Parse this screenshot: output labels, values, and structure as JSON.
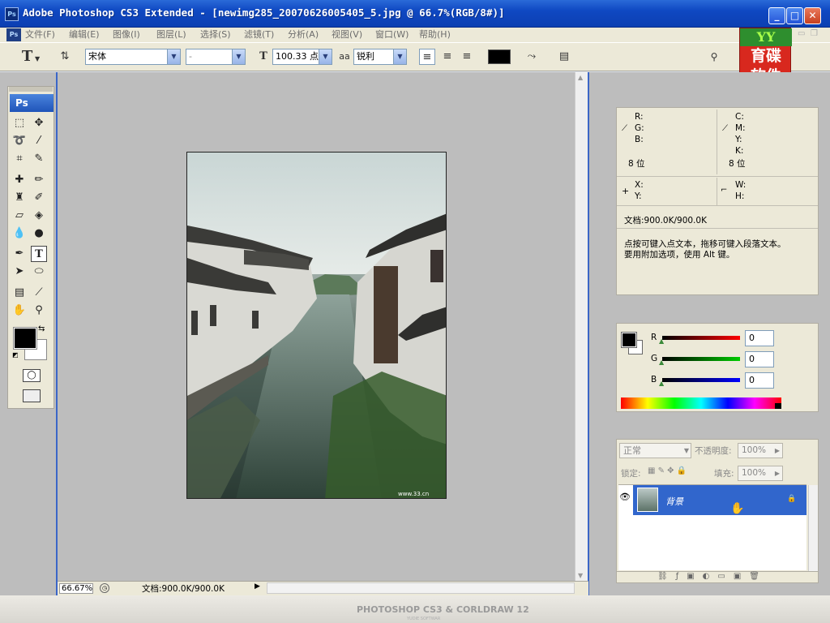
{
  "window": {
    "title": "Adobe Photoshop CS3 Extended - [newimg285_20070626005405_5.jpg @ 66.7%(RGB/8#)]",
    "app_icon": "Ps"
  },
  "menu": {
    "icon": "Ps",
    "items": [
      "文件(F)",
      "编辑(E)",
      "图像(I)",
      "图层(L)",
      "选择(S)",
      "滤镜(T)",
      "分析(A)",
      "视图(V)",
      "窗口(W)",
      "帮助(H)"
    ]
  },
  "options": {
    "tool_glyph": "T",
    "font_family": "宋体",
    "font_style": "-",
    "font_size": "100.33 点",
    "antialias_icon_text": "aa",
    "antialias": "锐利",
    "text_color": "#000000"
  },
  "logo": {
    "top": "YY",
    "line1": "育碟",
    "line2": "软件"
  },
  "toolbox": {
    "header": "Ps"
  },
  "status": {
    "zoom": "66.67%",
    "doc_size": "文档:900.0K/900.0K"
  },
  "info": {
    "rgb_labels": [
      "R:",
      "G:",
      "B:"
    ],
    "cmyk_labels": [
      "C:",
      "M:",
      "Y:",
      "K:"
    ],
    "bit_left": "8 位",
    "bit_right": "8 位",
    "x_label": "X:",
    "y_label": "Y:",
    "w_label": "W:",
    "h_label": "H:",
    "doc_size": "文档:900.0K/900.0K",
    "hint_line1": "点按可键入点文本，拖移可键入段落文本。",
    "hint_line2": "要用附加选项，使用 Alt 键。"
  },
  "color": {
    "r_label": "R",
    "g_label": "G",
    "b_label": "B",
    "r_value": "0",
    "g_value": "0",
    "b_value": "0",
    "foreground": "#000000",
    "background": "#ffffff"
  },
  "layers": {
    "blend_mode": "正常",
    "opacity_label": "不透明度:",
    "opacity_value": "100%",
    "lock_label": "锁定:",
    "fill_label": "填充:",
    "fill_value": "100%",
    "layer_name": "背景",
    "selected_color": "#3166cc"
  },
  "watermark": {
    "text": "PHOTOSHOP CS3 & CORLDRAW 12",
    "sub": "YUDIE SOFTWAR"
  }
}
